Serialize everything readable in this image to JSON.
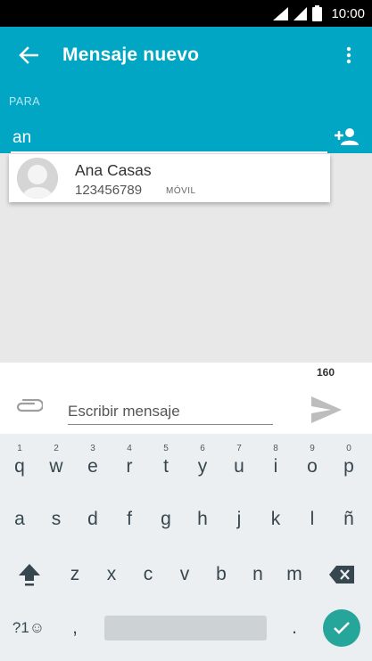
{
  "status_bar": {
    "time": "10:00"
  },
  "app_bar": {
    "title": "Mensaje nuevo",
    "to_label": "PARA",
    "to_value": "an"
  },
  "suggestion": {
    "name": "Ana Casas",
    "number": "123456789",
    "type": "MÓVIL"
  },
  "compose": {
    "char_count": "160",
    "placeholder": "Escribir mensaje"
  },
  "keyboard": {
    "row1": [
      {
        "key": "q",
        "hint": "1"
      },
      {
        "key": "w",
        "hint": "2"
      },
      {
        "key": "e",
        "hint": "3"
      },
      {
        "key": "r",
        "hint": "4"
      },
      {
        "key": "t",
        "hint": "5"
      },
      {
        "key": "y",
        "hint": "6"
      },
      {
        "key": "u",
        "hint": "7"
      },
      {
        "key": "i",
        "hint": "8"
      },
      {
        "key": "o",
        "hint": "9"
      },
      {
        "key": "p",
        "hint": "0"
      }
    ],
    "row2": [
      "a",
      "s",
      "d",
      "f",
      "g",
      "h",
      "j",
      "k",
      "l",
      "ñ"
    ],
    "row3": [
      "z",
      "x",
      "c",
      "v",
      "b",
      "n",
      "m"
    ],
    "symbols_label": "?1☺",
    "comma": ",",
    "period": "."
  },
  "colors": {
    "app_bar": "#00a6c4",
    "accent": "#26a69a",
    "status_bar": "#000000"
  }
}
